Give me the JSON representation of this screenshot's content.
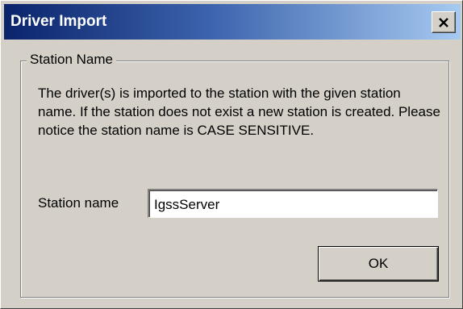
{
  "window": {
    "title": "Driver Import",
    "close_icon": "close-icon"
  },
  "group": {
    "legend": "Station Name",
    "description": "The driver(s) is imported to the station with the given station name. If the station does not exist a new station is created. Please notice the station name is CASE SENSITIVE."
  },
  "form": {
    "station_label": "Station name",
    "station_value": "IgssServer"
  },
  "buttons": {
    "ok_label": "OK"
  },
  "colors": {
    "titlebar_start": "#0a246a",
    "titlebar_end": "#a6caf0",
    "face": "#d4d0c8"
  }
}
